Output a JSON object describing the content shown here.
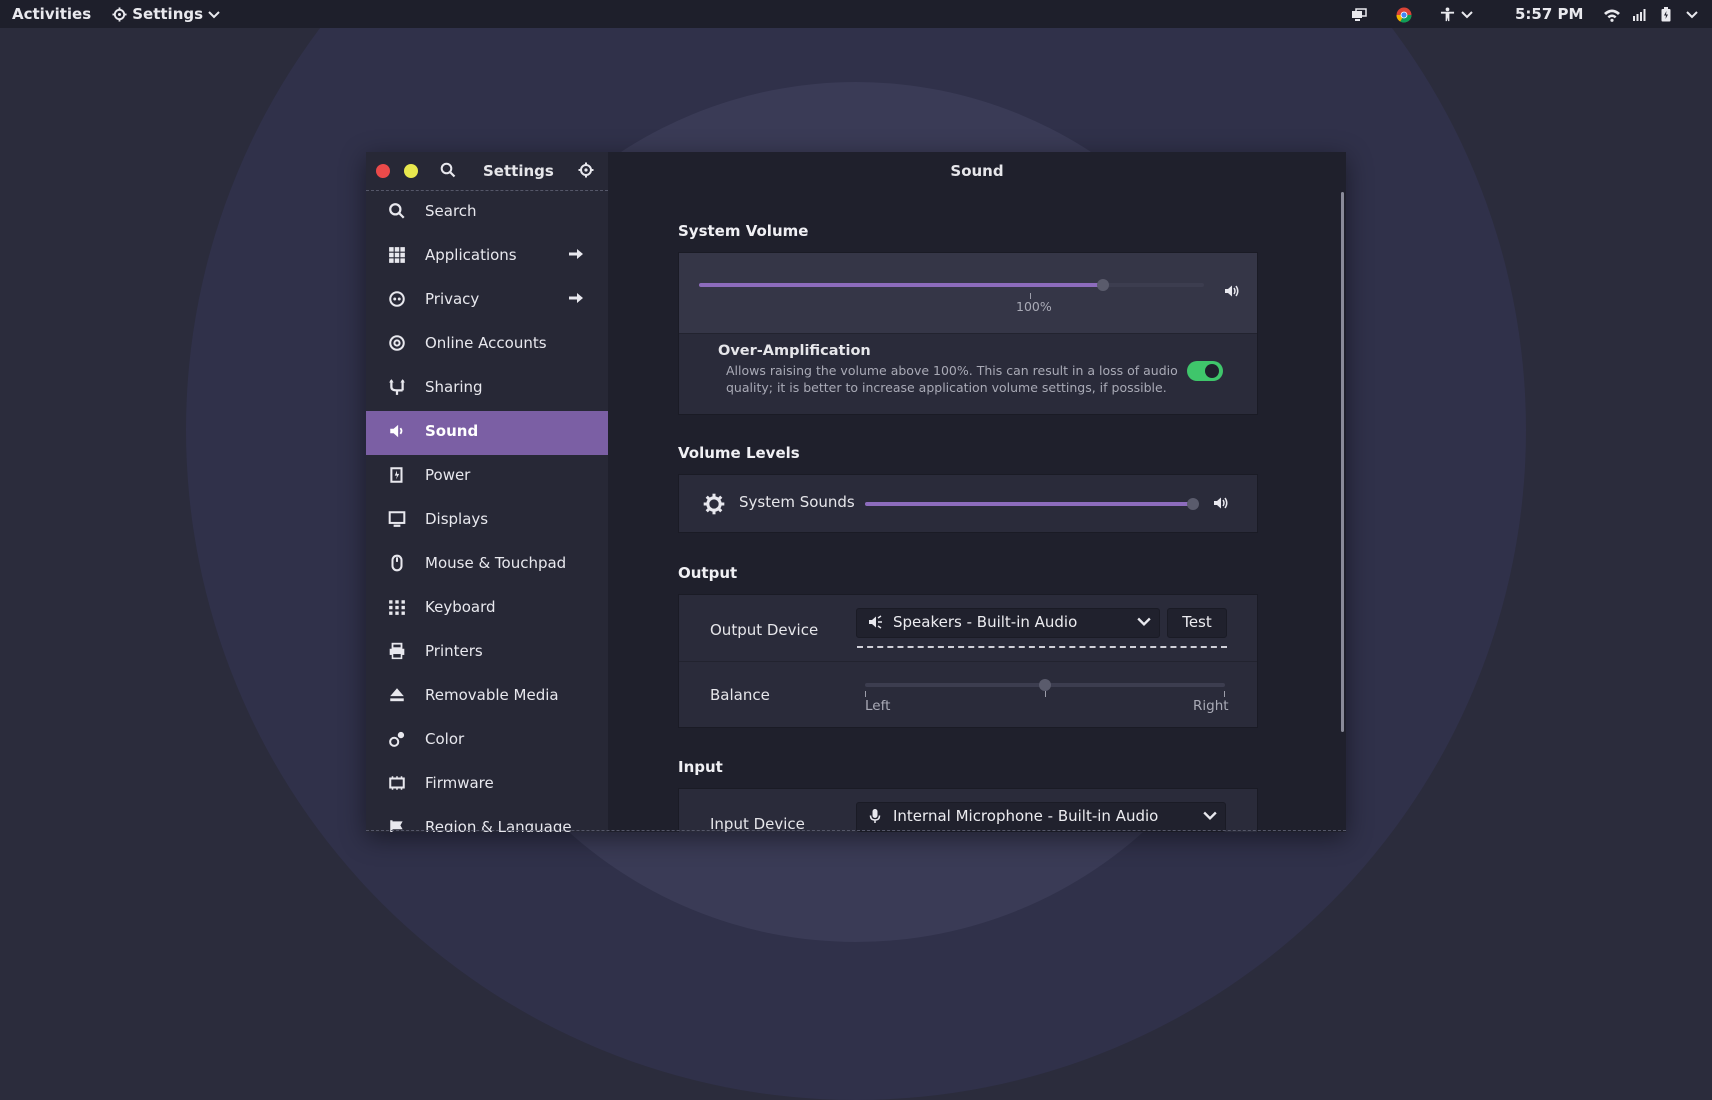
{
  "topbar": {
    "activities": "Activities",
    "app_menu": "Settings",
    "clock": "5:57 PM",
    "icons": [
      "display-icon",
      "chrome-icon",
      "accessibility-icon",
      "wifi-icon",
      "volume-icon",
      "battery-icon",
      "system-menu-chevron-icon"
    ]
  },
  "sidebar": {
    "title": "Settings",
    "items": [
      {
        "label": "Search",
        "icon": "search-icon"
      },
      {
        "label": "Applications",
        "icon": "grid-icon",
        "arrow": true
      },
      {
        "label": "Privacy",
        "icon": "privacy-icon",
        "arrow": true
      },
      {
        "label": "Online Accounts",
        "icon": "at-icon"
      },
      {
        "label": "Sharing",
        "icon": "share-icon"
      },
      {
        "label": "Sound",
        "icon": "speaker-icon",
        "active": true
      },
      {
        "label": "Power",
        "icon": "power-icon"
      },
      {
        "label": "Displays",
        "icon": "display-icon"
      },
      {
        "label": "Mouse & Touchpad",
        "icon": "mouse-icon"
      },
      {
        "label": "Keyboard",
        "icon": "keyboard-icon"
      },
      {
        "label": "Printers",
        "icon": "printer-icon"
      },
      {
        "label": "Removable Media",
        "icon": "eject-icon"
      },
      {
        "label": "Color",
        "icon": "color-icon"
      },
      {
        "label": "Firmware",
        "icon": "chip-icon"
      },
      {
        "label": "Region & Language",
        "icon": "flag-icon"
      }
    ]
  },
  "main": {
    "title": "Sound",
    "system_volume": {
      "section": "System Volume",
      "level": 0.8,
      "marker_label": "100%",
      "over_amp_title": "Over-Amplification",
      "over_amp_desc_1": "Allows raising the volume above 100%. This can result in a loss of audio",
      "over_amp_desc_2": "quality; it is better to increase application volume settings, if possible.",
      "over_amp_enabled": true
    },
    "volume_levels": {
      "section": "Volume Levels",
      "system_sounds_label": "System Sounds",
      "system_sounds_level": 1.0
    },
    "output": {
      "section": "Output",
      "device_label": "Output Device",
      "device_value": "Speakers - Built-in Audio",
      "test_label": "Test",
      "balance_label": "Balance",
      "balance_left": "Left",
      "balance_right": "Right",
      "balance_level": 0.5
    },
    "input": {
      "section": "Input",
      "device_label": "Input Device",
      "device_value": "Internal Microphone - Built-in Audio"
    }
  },
  "colors": {
    "accent": "#7b5fa4",
    "slider_fill": "#8d6cbd",
    "toggle_on": "#3fc66b",
    "close": "#ea4a4a",
    "minimize": "#e8e84e"
  }
}
